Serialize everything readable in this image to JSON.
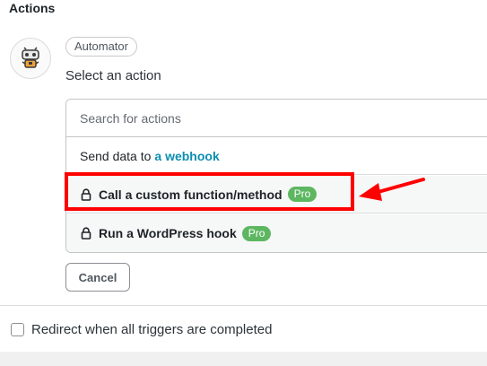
{
  "section": {
    "title": "Actions"
  },
  "integration": {
    "name": "Automator",
    "icon": "robot-icon"
  },
  "action_selector": {
    "prompt": "Select an action",
    "search_placeholder": "Search for actions",
    "options": [
      {
        "prefix": "Send data to",
        "highlight": "a webhook",
        "locked": false
      },
      {
        "label": "Call a custom function/method",
        "badge": "Pro",
        "locked": true,
        "highlighted": true
      },
      {
        "label": "Run a WordPress hook",
        "badge": "Pro",
        "locked": true
      }
    ]
  },
  "buttons": {
    "cancel": "Cancel"
  },
  "redirect": {
    "label": "Redirect when all triggers are completed",
    "checked": false
  },
  "colors": {
    "link": "#0c8eb0",
    "pro_badge": "#5db761",
    "annotation": "#ff0000"
  }
}
